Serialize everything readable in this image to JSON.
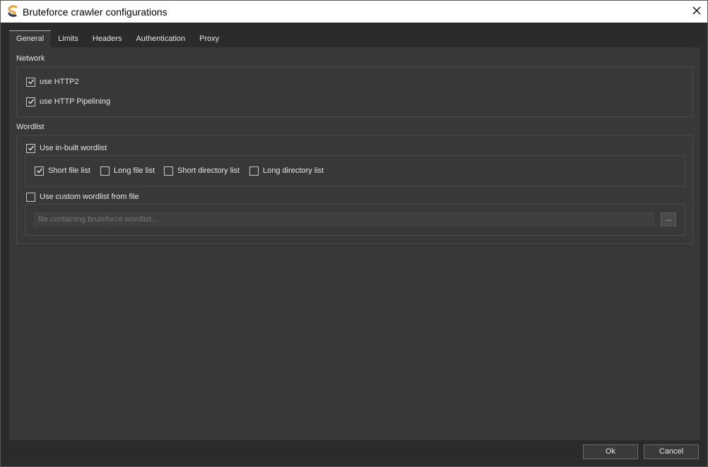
{
  "window": {
    "title": "Bruteforce crawler configurations",
    "app_icon": "app-s-logo-icon",
    "close_icon": "close-icon"
  },
  "tabs": [
    {
      "label": "General",
      "active": true
    },
    {
      "label": "Limits",
      "active": false
    },
    {
      "label": "Headers",
      "active": false
    },
    {
      "label": "Authentication",
      "active": false
    },
    {
      "label": "Proxy",
      "active": false
    }
  ],
  "network": {
    "section_label": "Network",
    "use_http2": {
      "label": "use HTTP2",
      "checked": true
    },
    "use_pipelining": {
      "label": "use HTTP Pipelining",
      "checked": true
    }
  },
  "wordlist": {
    "section_label": "Wordlist",
    "use_builtin": {
      "label": "Use in-built wordlist",
      "checked": true
    },
    "short_file_list": {
      "label": "Short file list",
      "checked": true
    },
    "long_file_list": {
      "label": "Long file list",
      "checked": false
    },
    "short_directory_list": {
      "label": "Short directory list",
      "checked": false
    },
    "long_directory_list": {
      "label": "Long directory list",
      "checked": false
    },
    "use_custom": {
      "label": "Use custom wordlist from file",
      "checked": false
    },
    "file_placeholder": "file containing bruteforce wordlist...",
    "browse_label": "..."
  },
  "footer": {
    "ok_label": "Ok",
    "cancel_label": "Cancel"
  },
  "colors": {
    "accent": "#e8a33d",
    "background": "#2b2b2b",
    "panel": "#383838"
  }
}
